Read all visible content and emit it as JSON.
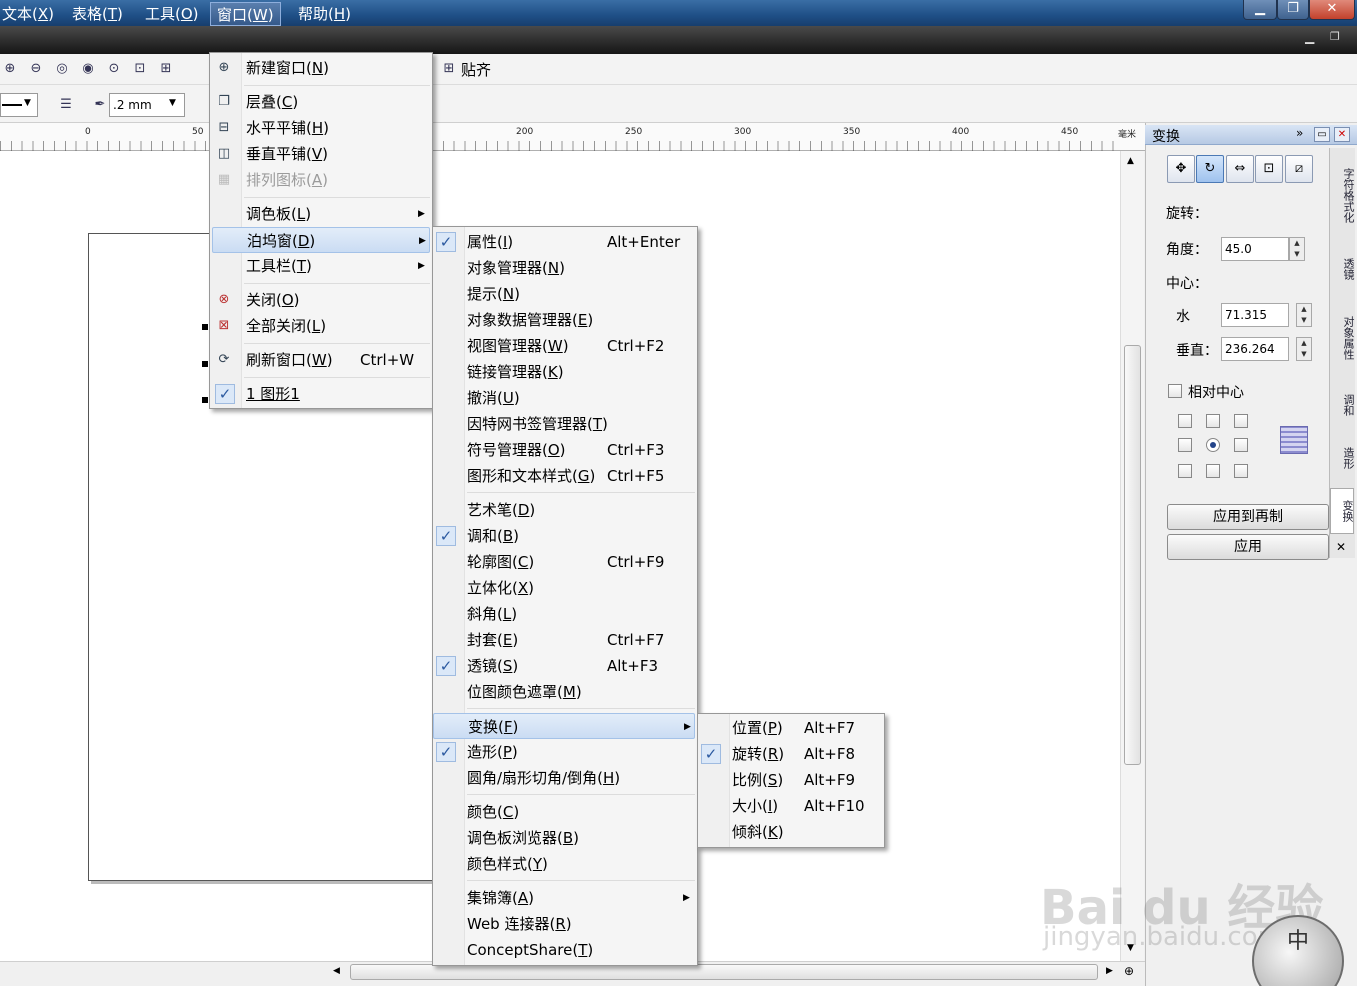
{
  "window": {
    "min": "▁",
    "max": "❐",
    "close": "✕"
  },
  "menubar": [
    {
      "label": "文本(",
      "key": "X",
      "suffix": ")"
    },
    {
      "label": "表格(",
      "key": "T",
      "suffix": ")"
    },
    {
      "label": "工具(",
      "key": "O",
      "suffix": ")"
    },
    {
      "label": "窗口(",
      "key": "W",
      "suffix": ")"
    },
    {
      "label": "帮助(",
      "key": "H",
      "suffix": ")"
    }
  ],
  "toolbar": {
    "snap_label": "贴齐",
    "outline_width": ".2 mm"
  },
  "ruler": {
    "ticks": [
      "0",
      "50",
      "200",
      "250",
      "300",
      "350",
      "400",
      "450"
    ],
    "unit": "毫米"
  },
  "window_menu": [
    {
      "label": "新建窗口(",
      "key": "N",
      "suffix": ")",
      "icon": "new-window-icon"
    },
    {
      "label": "层叠(",
      "key": "C",
      "suffix": ")",
      "icon": "cascade-icon"
    },
    {
      "label": "水平平铺(",
      "key": "H",
      "suffix": ")",
      "icon": "tile-horizontal-icon"
    },
    {
      "label": "垂直平铺(",
      "key": "V",
      "suffix": ")",
      "icon": "tile-vertical-icon"
    },
    {
      "label": "排列图标(",
      "key": "A",
      "suffix": ")",
      "icon": "arrange-icons-icon"
    },
    {
      "label": "调色板(",
      "key": "L",
      "suffix": ")"
    },
    {
      "label": "泊坞窗(",
      "key": "D",
      "suffix": ")"
    },
    {
      "label": "工具栏(",
      "key": "T",
      "suffix": ")"
    },
    {
      "label": "关闭(",
      "key": "O",
      "suffix": ")",
      "icon": "close-window-icon"
    },
    {
      "label": "全部关闭(",
      "key": "L",
      "suffix": ")",
      "icon": "close-all-icon"
    },
    {
      "label": "刷新窗口(",
      "key": "W",
      "suffix": ")",
      "shortcut": "Ctrl+W",
      "icon": "refresh-window-icon"
    },
    {
      "label": "1 图形1",
      "key": "",
      "suffix": "",
      "checked": true
    }
  ],
  "docker_menu": [
    {
      "label": "属性(",
      "key": "I",
      "suffix": ")",
      "shortcut": "Alt+Enter",
      "checked": true
    },
    {
      "label": "对象管理器(",
      "key": "N",
      "suffix": ")"
    },
    {
      "label": "提示(",
      "key": "N",
      "suffix": ")"
    },
    {
      "label": "对象数据管理器(",
      "key": "E",
      "suffix": ")"
    },
    {
      "label": "视图管理器(",
      "key": "W",
      "suffix": ")",
      "shortcut": "Ctrl+F2"
    },
    {
      "label": "链接管理器(",
      "key": "K",
      "suffix": ")"
    },
    {
      "label": "撤消(",
      "key": "U",
      "suffix": ")"
    },
    {
      "label": "因特网书签管理器(",
      "key": "T",
      "suffix": ")"
    },
    {
      "label": "符号管理器(",
      "key": "O",
      "suffix": ")",
      "shortcut": "Ctrl+F3"
    },
    {
      "label": "图形和文本样式(",
      "key": "G",
      "suffix": ")",
      "shortcut": "Ctrl+F5"
    },
    {
      "label": "艺术笔(",
      "key": "D",
      "suffix": ")"
    },
    {
      "label": "调和(",
      "key": "B",
      "suffix": ")",
      "checked": true
    },
    {
      "label": "轮廓图(",
      "key": "C",
      "suffix": ")",
      "shortcut": "Ctrl+F9"
    },
    {
      "label": "立体化(",
      "key": "X",
      "suffix": ")"
    },
    {
      "label": "斜角(",
      "key": "L",
      "suffix": ")"
    },
    {
      "label": "封套(",
      "key": "E",
      "suffix": ")",
      "shortcut": "Ctrl+F7"
    },
    {
      "label": "透镜(",
      "key": "S",
      "suffix": ")",
      "shortcut": "Alt+F3",
      "checked": true
    },
    {
      "label": "位图颜色遮罩(",
      "key": "M",
      "suffix": ")"
    },
    {
      "label": "变换(",
      "key": "F",
      "suffix": ")"
    },
    {
      "label": "造形(",
      "key": "P",
      "suffix": ")",
      "checked": true
    },
    {
      "label": "圆角/扇形切角/倒角(",
      "key": "H",
      "suffix": ")"
    },
    {
      "label": "颜色(",
      "key": "C",
      "suffix": ")"
    },
    {
      "label": "调色板浏览器(",
      "key": "B",
      "suffix": ")"
    },
    {
      "label": "颜色样式(",
      "key": "Y",
      "suffix": ")"
    },
    {
      "label": "集锦簿(",
      "key": "A",
      "suffix": ")"
    },
    {
      "label": "Web 连接器(",
      "key": "R",
      "suffix": ")"
    },
    {
      "label": "ConceptShare(",
      "key": "T",
      "suffix": ")"
    }
  ],
  "transform_menu": [
    {
      "label": "位置(",
      "key": "P",
      "suffix": ")",
      "shortcut": "Alt+F7"
    },
    {
      "label": "旋转(",
      "key": "R",
      "suffix": ")",
      "shortcut": "Alt+F8",
      "checked": true
    },
    {
      "label": "比例(",
      "key": "S",
      "suffix": ")",
      "shortcut": "Alt+F9"
    },
    {
      "label": "大小(",
      "key": "I",
      "suffix": ")",
      "shortcut": "Alt+F10"
    },
    {
      "label": "倾斜(",
      "key": "K",
      "suffix": ")"
    }
  ],
  "docker": {
    "title": "变换",
    "rotate_label": "旋转：",
    "angle_label": "角度：",
    "angle_value": "45.0",
    "center_label": "中心：",
    "horizontal_label": "水",
    "horizontal_value": "71.315",
    "vertical_label": "垂直：",
    "vertical_value": "236.264",
    "relative_center": "相对中心",
    "apply_copy": "应用到再制",
    "apply": "应用",
    "side_tabs": [
      "字符格式化",
      "透镜",
      "对象属性",
      "调和",
      "造形",
      "变换"
    ]
  },
  "watermark": {
    "brand": "Bai du 经验",
    "url": "jingyan.baidu.com",
    "ime": "中"
  }
}
